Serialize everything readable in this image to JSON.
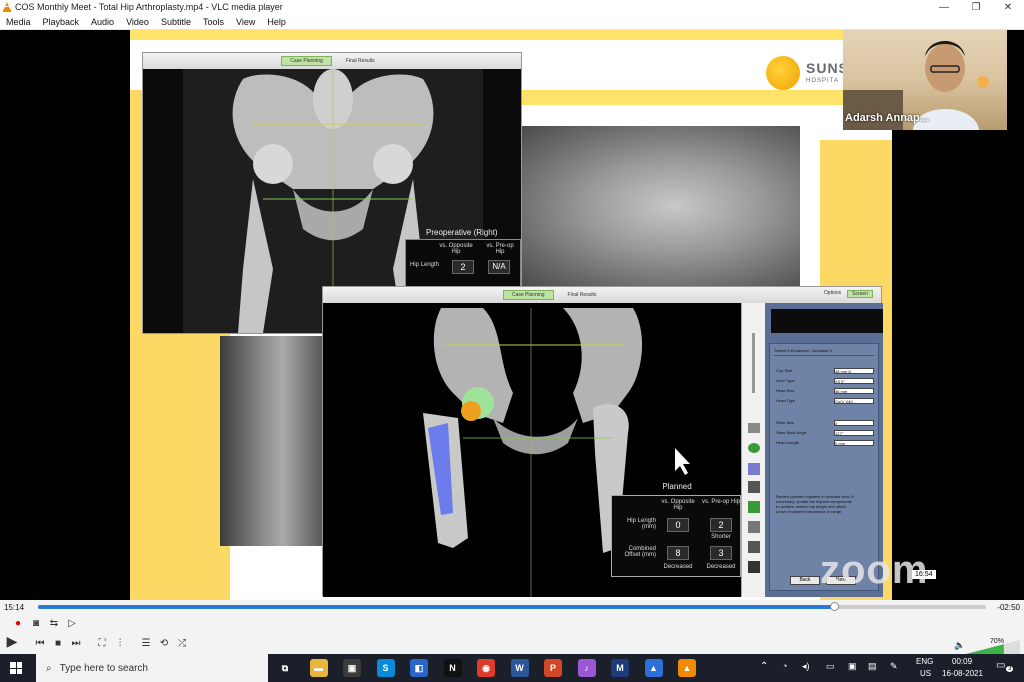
{
  "window": {
    "title": "COS Monthly Meet -  Total Hip Arthroplasty.mp4 - VLC media player",
    "minimize_glyph": "—",
    "maximize_glyph": "❐",
    "close_glyph": "✕"
  },
  "menu": [
    "Media",
    "Playback",
    "Audio",
    "Video",
    "Subtitle",
    "Tools",
    "View",
    "Help"
  ],
  "slide": {
    "logo_text": "SUNS",
    "logo_sub": "HOSPITA",
    "preop_window": {
      "tabs": [
        "Case Planning",
        "Final Results"
      ],
      "heading": "Preoperative (Right)",
      "col1": "vs. Opposite Hip",
      "col2": "vs. Pre-op Hip",
      "row_label": "Hip Length",
      "value_opposite": "2",
      "value_preop": "N/A"
    },
    "planned_window": {
      "tabs": [
        "Case Planning",
        "Final Results"
      ],
      "options": [
        "Options",
        "Screen"
      ],
      "panel_title": "Trident II Enhanced - Accolade II",
      "panel_rows": [
        "Cup Size",
        "Liner Type",
        "Head Size",
        "Head Type",
        "Stem Size",
        "Stem Neck Angle",
        "Head Length"
      ],
      "panel_values": [
        "48 mm D",
        "X3 0°",
        "36 mm",
        "CoCr V40",
        "2",
        "127°",
        "0 mm"
      ],
      "panel_note": "Review planned implants in reduced view. If necessary, update the implant components to achieve desired hip length and offset. Leave trochanter landmarks in range.",
      "panel_buttons": [
        "Back",
        "Next"
      ],
      "heading": "Planned",
      "col1": "vs. Opposite Hip",
      "col2": "vs. Pre-op Hip",
      "row1_label": "Hip Length (mm)",
      "row2_label": "Combined Offset (mm)",
      "hip_length_opposite": "0",
      "hip_length_preop": "2",
      "hip_length_preop_note": "Shorter",
      "offset_opposite": "8",
      "offset_opposite_note": "Decreased",
      "offset_preop": "3",
      "offset_preop_note": "Decreased"
    }
  },
  "webcam": {
    "name": "Adarsh Annap..."
  },
  "zoom_watermark": "zoom",
  "video_timestamp": "16:54",
  "player": {
    "elapsed": "15:14",
    "remaining": "-02:50",
    "progress": 0.84,
    "volume": "70%",
    "volume_level": 0.7
  },
  "taskbar": {
    "search_placeholder": "Type here to search",
    "lang_top": "ENG",
    "lang_bottom": "US",
    "time": "00:09",
    "date": "16-08-2021",
    "notification_count": "3",
    "apps": [
      {
        "name": "task-view-icon",
        "glyph": "⧉",
        "color": "#1b1f2a"
      },
      {
        "name": "file-explorer-icon",
        "glyph": "▬",
        "color": "#e8b63a"
      },
      {
        "name": "store-icon",
        "glyph": "▣",
        "color": "#3b3b3b"
      },
      {
        "name": "skype-icon",
        "glyph": "S",
        "color": "#0a8ad8"
      },
      {
        "name": "app-icon",
        "glyph": "◧",
        "color": "#2a66c9"
      },
      {
        "name": "netflix-icon",
        "glyph": "N",
        "color": "#111"
      },
      {
        "name": "chrome-icon",
        "glyph": "◉",
        "color": "#dd3b2b"
      },
      {
        "name": "word-icon",
        "glyph": "W",
        "color": "#2b579a"
      },
      {
        "name": "powerpoint-icon",
        "glyph": "P",
        "color": "#d24726"
      },
      {
        "name": "music-icon",
        "glyph": "♪",
        "color": "#9a58d6"
      },
      {
        "name": "m-app-icon",
        "glyph": "M",
        "color": "#1d3b7a"
      },
      {
        "name": "photos-icon",
        "glyph": "▲",
        "color": "#2c6fd6"
      },
      {
        "name": "vlc-icon",
        "glyph": "▲",
        "color": "#f08a00"
      }
    ]
  }
}
